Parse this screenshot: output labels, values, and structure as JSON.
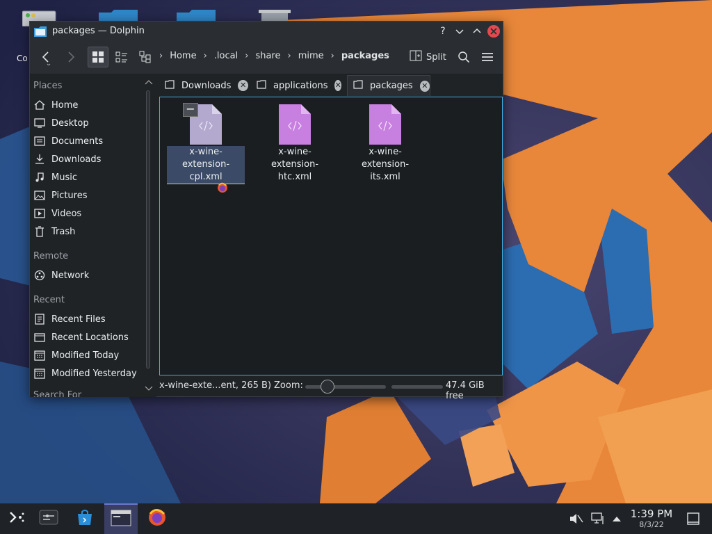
{
  "desktop": {
    "partial_icon_label": "Co"
  },
  "window": {
    "title": "packages — Dolphin",
    "help_glyph": "?",
    "minimize_glyph": "⌄",
    "maximize_glyph": "⌃",
    "close_glyph": "✕"
  },
  "toolbar": {
    "breadcrumb": [
      "Home",
      ".local",
      "share",
      "mime",
      "packages"
    ],
    "split_label": "Split"
  },
  "sidebar": {
    "places_header": "Places",
    "places": [
      {
        "label": "Home",
        "icon": "home-icon"
      },
      {
        "label": "Desktop",
        "icon": "desktop-icon"
      },
      {
        "label": "Documents",
        "icon": "documents-icon"
      },
      {
        "label": "Downloads",
        "icon": "downloads-icon"
      },
      {
        "label": "Music",
        "icon": "music-icon"
      },
      {
        "label": "Pictures",
        "icon": "pictures-icon"
      },
      {
        "label": "Videos",
        "icon": "videos-icon"
      },
      {
        "label": "Trash",
        "icon": "trash-icon"
      }
    ],
    "remote_header": "Remote",
    "remote": [
      {
        "label": "Network",
        "icon": "network-icon"
      }
    ],
    "recent_header": "Recent",
    "recent": [
      {
        "label": "Recent Files",
        "icon": "recent-files-icon"
      },
      {
        "label": "Recent Locations",
        "icon": "recent-locations-icon"
      },
      {
        "label": "Modified Today",
        "icon": "calendar-icon"
      },
      {
        "label": "Modified Yesterday",
        "icon": "calendar-icon"
      }
    ],
    "partial_header": "Search For"
  },
  "tabs": [
    {
      "label": "Downloads",
      "active": false
    },
    {
      "label": "applications",
      "active": false
    },
    {
      "label": "packages",
      "active": true
    }
  ],
  "files": [
    {
      "line1": "x-wine-extension-",
      "line2": "cpl.xml",
      "selected": true
    },
    {
      "line1": "x-wine-extension-",
      "line2": "htc.xml",
      "selected": false
    },
    {
      "line1": "x-wine-extension-",
      "line2": "its.xml",
      "selected": false
    }
  ],
  "statusbar": {
    "status_text": "x-wine-exte...ent, 265 B)",
    "zoom_label": "Zoom:",
    "free_space": "47.4 GiB free"
  },
  "taskbar": {
    "time": "1:39 PM",
    "date": "8/3/22"
  },
  "colors": {
    "accent": "#3daee9",
    "close": "#e34a4f",
    "xml_icon": "#c77fe0",
    "wallpaper_orange": "#e8873a",
    "wallpaper_blue": "#2b5d9b"
  }
}
